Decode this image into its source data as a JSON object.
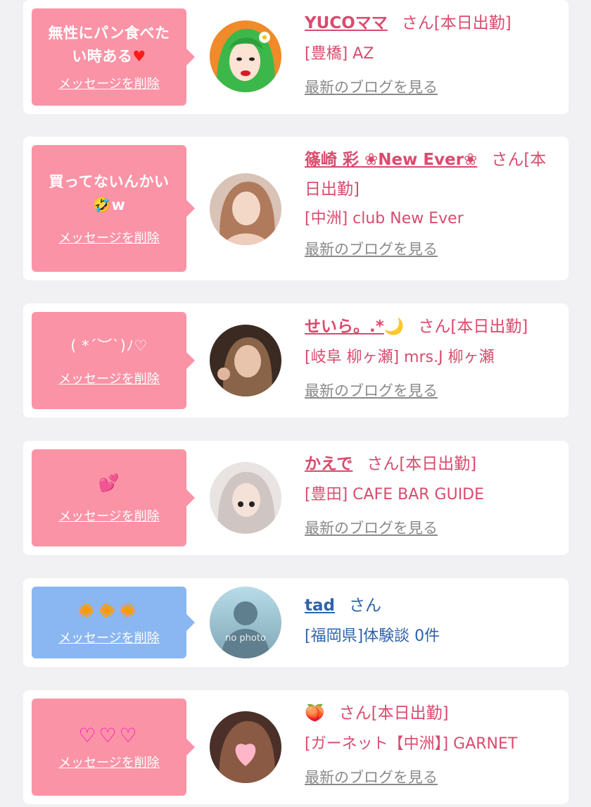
{
  "cards": [
    {
      "message_line1": "無性にパン食べた",
      "message_line2": "い時ある",
      "message_emoji": "♥",
      "delete_label": "メッセージを削除",
      "name": "YUCOママ",
      "suffix": "さん[本日出勤]",
      "location": "[豊橋] AZ",
      "blog_label": "最新のブログを見る"
    },
    {
      "message_line1": "買ってないんかい",
      "message_line2": "w",
      "message_emoji": "🤣",
      "delete_label": "メッセージを削除",
      "name": "篠崎 彩 ❀New Ever❀",
      "suffix": "さん[本",
      "suffix2": "日出勤]",
      "location": "[中洲] club New Ever",
      "blog_label": "最新のブログを見る"
    },
    {
      "message_line1": "( *´︶`)ﾉ♡",
      "delete_label": "メッセージを削除",
      "name": "せいら。.*",
      "name_emoji": "🌙",
      "suffix": "さん[本日出勤]",
      "location": "[岐阜 柳ヶ瀬] mrs.J 柳ヶ瀬",
      "blog_label": "最新のブログを見る"
    },
    {
      "message_emoji": "💕",
      "delete_label": "メッセージを削除",
      "name": "かえで",
      "suffix": "さん[本日出勤]",
      "location": "[豊田] CAFE BAR GUIDE",
      "blog_label": "最新のブログを見る"
    },
    {
      "message_emoji": "✺✺✺",
      "delete_label": "メッセージを削除",
      "name": "tad",
      "suffix": "さん",
      "location": "[福岡県]体験談 0件",
      "avatar_text": "no photo"
    },
    {
      "message_emoji": "♡♡♡",
      "delete_label": "メッセージを削除",
      "name_emoji": "🍑",
      "suffix": "さん[本日出勤]",
      "location": "[ガーネット【中洲】] GARNET",
      "blog_label": "最新のブログを見る"
    }
  ]
}
